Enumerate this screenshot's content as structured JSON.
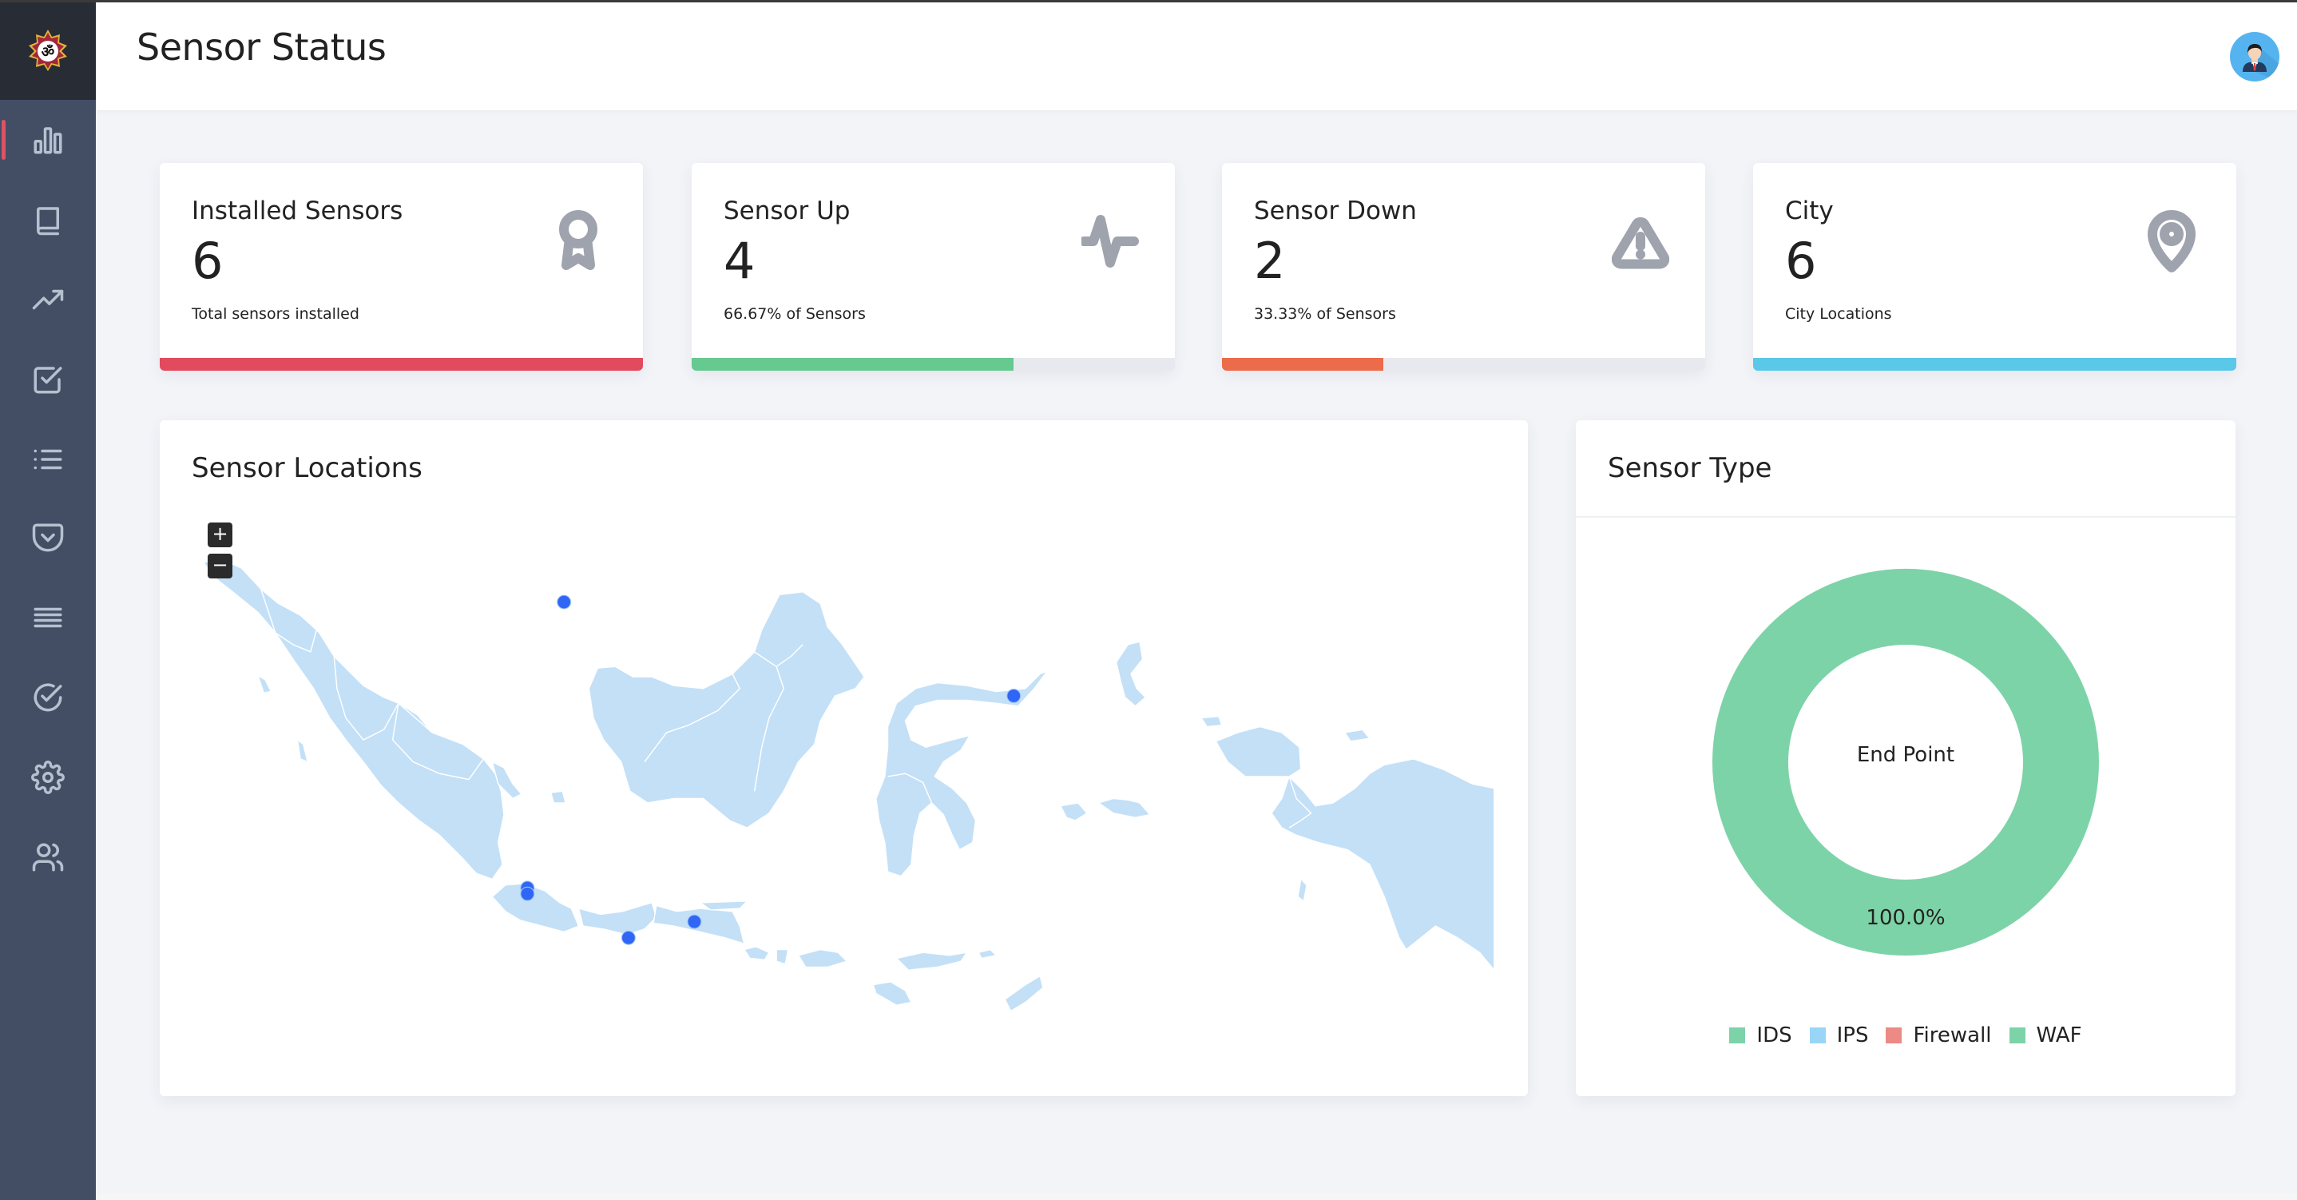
{
  "header": {
    "title": "Sensor Status",
    "avatar_icon": "user-avatar-icon"
  },
  "sidebar": {
    "logo_icon": "brand-logo-icon",
    "items": [
      {
        "icon": "bar-chart-icon",
        "active": true
      },
      {
        "icon": "book-icon",
        "active": false
      },
      {
        "icon": "trending-up-icon",
        "active": false
      },
      {
        "icon": "check-square-icon",
        "active": false
      },
      {
        "icon": "list-icon",
        "active": false
      },
      {
        "icon": "pocket-shield-icon",
        "active": false
      },
      {
        "icon": "menu-lines-icon",
        "active": false
      },
      {
        "icon": "check-circle-icon",
        "active": false
      },
      {
        "icon": "gear-icon",
        "active": false
      },
      {
        "icon": "users-icon",
        "active": false
      }
    ]
  },
  "stats": [
    {
      "label": "Installed Sensors",
      "value": "6",
      "sub": "Total sensors installed",
      "icon": "award-icon",
      "color": "#e24a5e",
      "progress": 1.0
    },
    {
      "label": "Sensor Up",
      "value": "4",
      "sub": "66.67% of Sensors",
      "icon": "activity-icon",
      "color": "#66c98f",
      "progress": 0.6667
    },
    {
      "label": "Sensor Down",
      "value": "2",
      "sub": "33.33% of Sensors",
      "icon": "alert-triangle-icon",
      "color": "#eb6b4b",
      "progress": 0.3333
    },
    {
      "label": "City",
      "value": "6",
      "sub": "City Locations",
      "icon": "map-pin-icon",
      "color": "#5bc8e8",
      "progress": 1.0
    }
  ],
  "map": {
    "title": "Sensor Locations",
    "zoom_in_label": "+",
    "zoom_out_label": "−",
    "land_color": "#c3e0f7",
    "marker_color": "#2f66f5",
    "marker_count": 6
  },
  "sensor_type": {
    "title": "Sensor Type",
    "center_label": "End Point",
    "slice_label": "100.0%",
    "legend": [
      {
        "label": "IDS",
        "color": "#7dd3a8"
      },
      {
        "label": "IPS",
        "color": "#99d5f7"
      },
      {
        "label": "Firewall",
        "color": "#ec8a84"
      },
      {
        "label": "WAF",
        "color": "#7dd3a8"
      }
    ]
  },
  "chart_data": {
    "type": "pie",
    "title": "Sensor Type",
    "center_label": "End Point",
    "categories": [
      "End Point"
    ],
    "values": [
      100.0
    ],
    "value_labels": [
      "100.0%"
    ],
    "legend": [
      "IDS",
      "IPS",
      "Firewall",
      "WAF"
    ],
    "legend_placement": "bottom"
  }
}
